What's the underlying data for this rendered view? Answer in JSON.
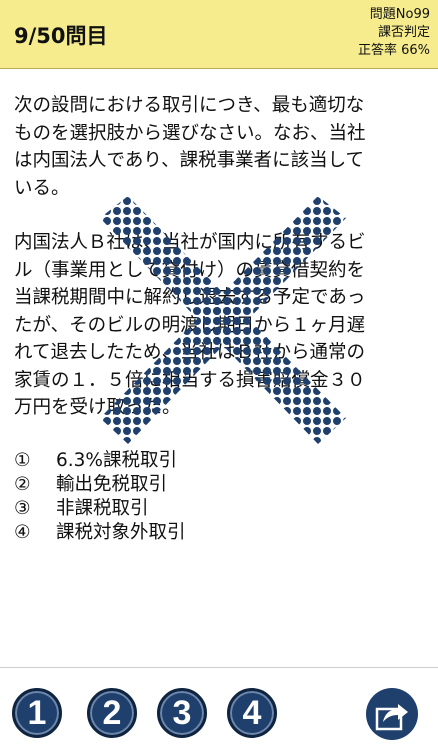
{
  "header": {
    "title": "9/50問目",
    "problem_no": "問題No99",
    "category": "課否判定",
    "accuracy": "正答率 66%"
  },
  "question": {
    "instruction_lines": [
      "次の設問における取引につき、最も適切な",
      "ものを選択肢から選びなさい。なお、当社",
      "は内国法人であり、課税事業者に該当して",
      "いる。"
    ],
    "case_lines": [
      "内国法人Ｂ社は、当社が国内に所有するビ",
      "ル（事業用として貸付け）の賃貸借契約を",
      "当課税期間中に解約し退去する予定であっ",
      "たが、そのビルの明渡し期日から１ヶ月遅",
      "れて退去したため、当社はＢ社から通常の",
      "家賃の１．５倍に相当する損害賠償金３０",
      "万円を受け取った。"
    ]
  },
  "choices": [
    {
      "num": "①",
      "text": "6.3%課税取引"
    },
    {
      "num": "②",
      "text": "輸出免税取引"
    },
    {
      "num": "③",
      "text": "非課税取引"
    },
    {
      "num": "④",
      "text": "課税対象外取引"
    }
  ],
  "footer": {
    "answer_buttons": [
      "1",
      "2",
      "3",
      "4"
    ]
  },
  "colors": {
    "header_bg": "#f6ec8e",
    "accent": "#1f3f6d"
  }
}
